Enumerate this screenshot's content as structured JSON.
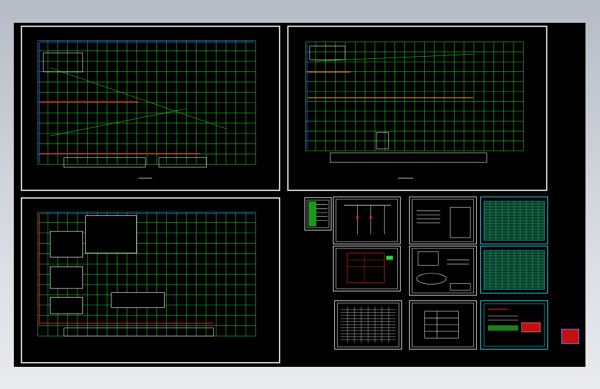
{
  "app": {
    "title": ""
  },
  "colors": {
    "background_top": "#b6bcc6",
    "viewport": "#000000",
    "grid": "#2bd62b",
    "sheet_border": "#cfcfcf",
    "cyan_sheet_border": "#22d4e6",
    "red_line": "#e02020",
    "blue_line": "#2a48ff",
    "orange_line": "#e08a18",
    "legend_fill": "#c41010"
  },
  "sheets": [
    {
      "id": "plan-1",
      "kind": "floor-plan"
    },
    {
      "id": "plan-2",
      "kind": "floor-plan"
    },
    {
      "id": "plan-3",
      "kind": "floor-plan"
    },
    {
      "id": "legend-table",
      "kind": "table"
    },
    {
      "id": "schematic-1",
      "kind": "schematic"
    },
    {
      "id": "notes-1",
      "kind": "notes"
    },
    {
      "id": "cyan-table-1",
      "kind": "table"
    },
    {
      "id": "schematic-red",
      "kind": "schematic"
    },
    {
      "id": "schematic-2",
      "kind": "schematic"
    },
    {
      "id": "cyan-table-2",
      "kind": "table"
    },
    {
      "id": "material-list",
      "kind": "table"
    },
    {
      "id": "title-table",
      "kind": "table"
    },
    {
      "id": "cyan-detail",
      "kind": "detail"
    }
  ]
}
